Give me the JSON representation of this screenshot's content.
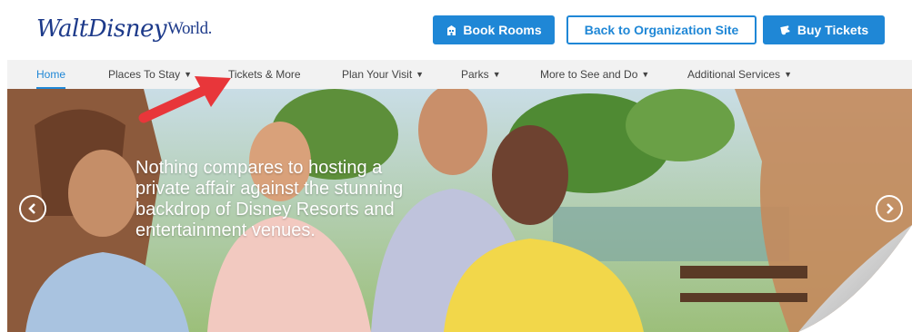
{
  "logo": {
    "main": "WaltDisney",
    "suffix": "World."
  },
  "buttons": {
    "book_rooms": "Book Rooms",
    "back_to_org": "Back to Organization Site",
    "buy_tickets": "Buy Tickets"
  },
  "nav": {
    "items": [
      {
        "label": "Home",
        "dropdown": false,
        "active": true
      },
      {
        "label": "Places To Stay",
        "dropdown": true
      },
      {
        "label": "Tickets & More",
        "dropdown": false
      },
      {
        "label": "Plan Your Visit",
        "dropdown": true
      },
      {
        "label": "Parks",
        "dropdown": true
      },
      {
        "label": "More to See and Do",
        "dropdown": true
      },
      {
        "label": "Additional Services",
        "dropdown": true
      }
    ]
  },
  "hero": {
    "caption": "Nothing compares to hosting a private affair against the stunning backdrop of Disney Resorts and entertainment venues."
  },
  "colors": {
    "accent": "#1f87d6",
    "nav_bg": "#f2f2f2",
    "annotation_arrow": "#e8363a"
  },
  "icons": {
    "book": "hotel-icon",
    "buy": "ticket-icon",
    "prev": "chevron-left-icon",
    "next": "chevron-right-icon"
  }
}
